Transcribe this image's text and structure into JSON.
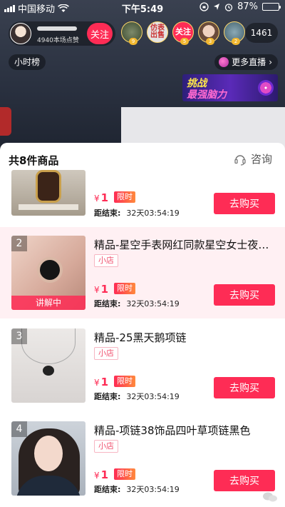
{
  "status_bar": {
    "carrier": "中国移动",
    "time": "下午5:49",
    "battery": "87%",
    "battery_level": 0.87
  },
  "host": {
    "likes": "4940本场点赞",
    "follow_label": "关注"
  },
  "viewers": {
    "avatars": [
      {
        "badge": "9",
        "text": ""
      },
      {
        "badge": "",
        "text": "仿表 出售"
      },
      {
        "badge": "5",
        "text": "关注"
      },
      {
        "badge": "3",
        "text": ""
      },
      {
        "badge": "2",
        "text": ""
      }
    ],
    "count": "1461"
  },
  "rank_label": "小时榜",
  "more_live_label": "更多直播",
  "banner": {
    "line1": "挑战",
    "line2": "最强脑力"
  },
  "sheet": {
    "title": "共8件商品",
    "consult_label": "咨询"
  },
  "products": [
    {
      "number": "",
      "title": "",
      "shop_tag": "",
      "currency": "¥",
      "price": "1",
      "limited_tag": "限时",
      "countdown_label": "距结束:",
      "countdown": "32天03:54:19",
      "buy_label": "去购买",
      "live_tag": ""
    },
    {
      "number": "2",
      "title": "精品-星空手表网红同款星空女士夜…",
      "shop_tag": "小店",
      "currency": "¥",
      "price": "1",
      "limited_tag": "限时",
      "countdown_label": "距结束:",
      "countdown": "32天03:54:19",
      "buy_label": "去购买",
      "live_tag": "讲解中"
    },
    {
      "number": "3",
      "title": "精品-25黑天鹅项链",
      "shop_tag": "小店",
      "currency": "¥",
      "price": "1",
      "limited_tag": "限时",
      "countdown_label": "距结束:",
      "countdown": "32天03:54:19",
      "buy_label": "去购买",
      "live_tag": ""
    },
    {
      "number": "4",
      "title": "精品-项链38饰品四叶草项链黑色",
      "shop_tag": "小店",
      "currency": "¥",
      "price": "1",
      "limited_tag": "限时",
      "countdown_label": "距结束:",
      "countdown": "32天03:54:19",
      "buy_label": "去购买",
      "live_tag": ""
    }
  ],
  "colors": {
    "accent": "#fe2c55",
    "active_row": "#fff0f3"
  }
}
